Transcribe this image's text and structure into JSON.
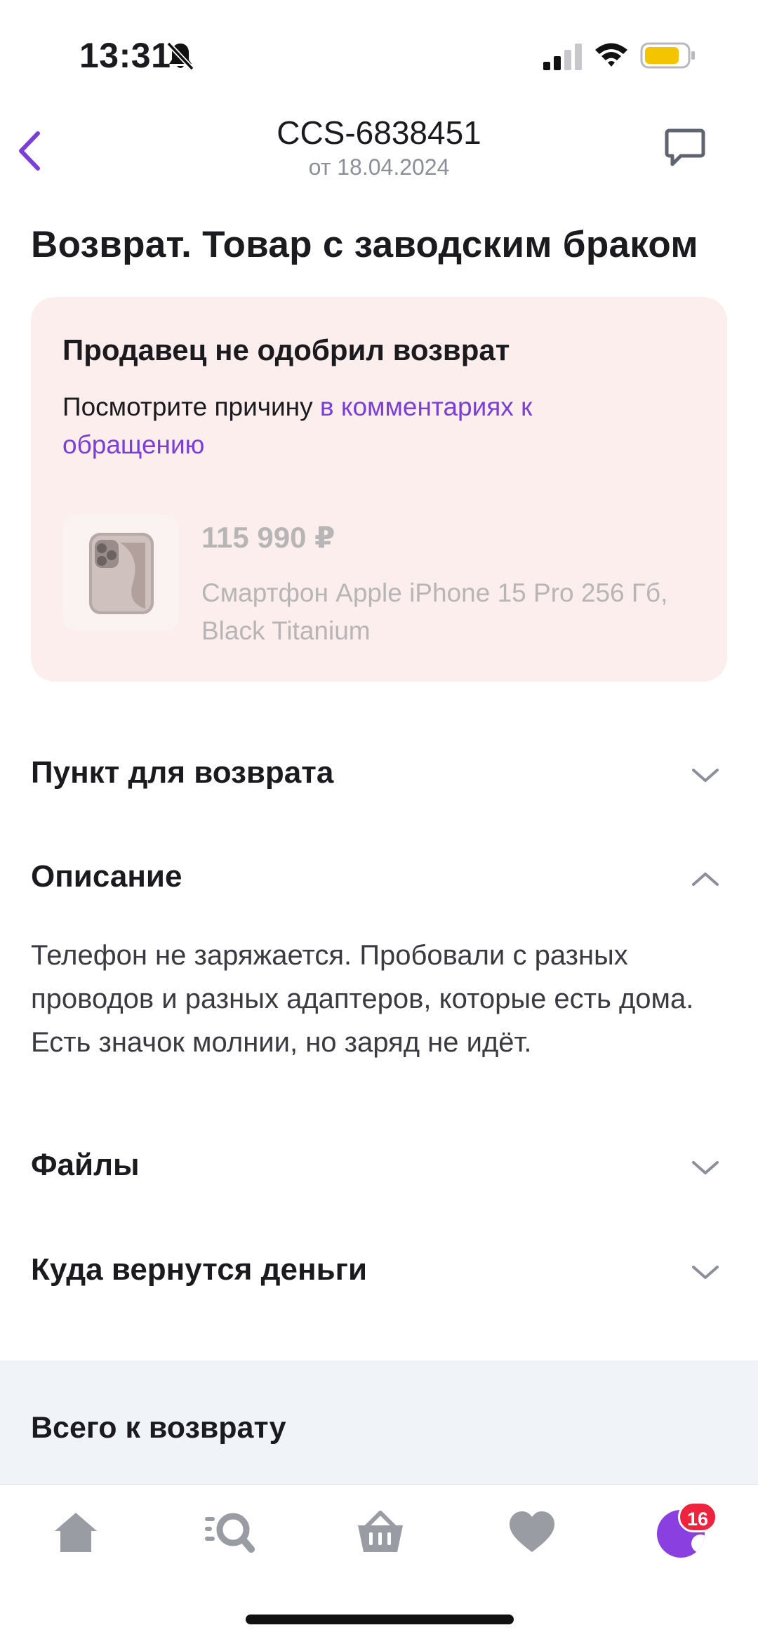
{
  "status_bar": {
    "time": "13:31",
    "icons": [
      "bell-slash-icon",
      "signal-icon",
      "wifi-icon",
      "battery-icon"
    ],
    "battery_color": "#f5c400"
  },
  "header": {
    "order_number": "CCS-6838451",
    "order_date": "от 18.04.2024",
    "back_icon": "chevron-left-icon",
    "chat_icon": "chat-bubble-icon"
  },
  "page": {
    "title": "Возврат. Товар с заводским браком"
  },
  "status_card": {
    "title": "Продавец не одобрил возврат",
    "text_before_link": "Посмотрите причину ",
    "link_text": "в комментариях к обращению",
    "background": "#fdeeee",
    "link_color": "#7b3fd8",
    "product": {
      "price": "115 990 ₽",
      "name": "Смартфон Apple iPhone 15 Pro 256 Гб, Black Titanium"
    }
  },
  "sections": [
    {
      "title": "Пункт для возврата",
      "expanded": false
    },
    {
      "title": "Описание",
      "expanded": true,
      "body": "Телефон не заряжается. Пробовали с разных проводов и разных адаптеров, которые есть дома. Есть значок молнии, но заряд не идёт."
    },
    {
      "title": "Файлы",
      "expanded": false
    },
    {
      "title": "Куда вернутся деньги",
      "expanded": false
    }
  ],
  "total": {
    "label": "Всего к возврату"
  },
  "tab_bar": {
    "tabs": [
      "home-icon",
      "catalog-search-icon",
      "cart-icon",
      "favorites-heart-icon",
      "profile-avatar"
    ],
    "profile_badge": "16",
    "accent": "#8a3fe0",
    "badge_color": "#f0233f"
  }
}
